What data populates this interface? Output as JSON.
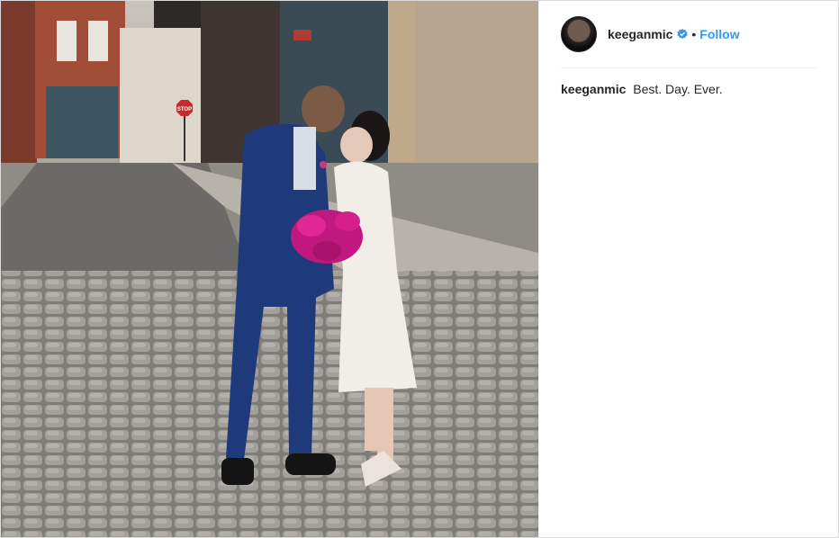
{
  "post": {
    "username": "keeganmic",
    "separator": "•",
    "follow_label": "Follow",
    "caption_user": "keeganmic",
    "caption_text": "Best. Day. Ever.",
    "photo_sign": "STOP"
  },
  "colors": {
    "accent": "#3897f0",
    "text": "#262626",
    "border": "#dbdbdb",
    "verified": "#3897f0"
  },
  "icons": {
    "verified": "verified-badge-icon"
  }
}
